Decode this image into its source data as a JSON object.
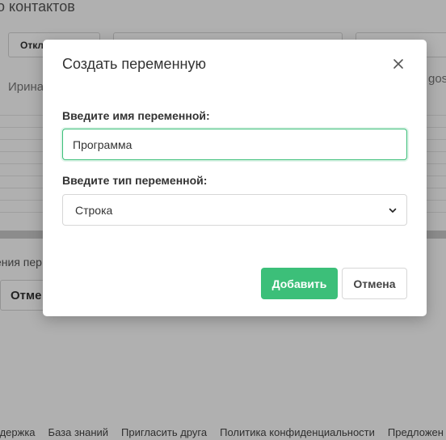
{
  "background": {
    "page_title": "о контактов",
    "toolbar_button": "Откл",
    "contact_name": "Ирина",
    "contact_right": "gos",
    "section_text": "ения пер",
    "cancel_label": "Отме"
  },
  "footer": {
    "links": [
      "ддержка",
      "База знаний",
      "Пригласить друга",
      "Политика конфиденциальности",
      "Предложен"
    ]
  },
  "modal": {
    "title": "Создать переменную",
    "close_icon": "close-icon",
    "name_label": "Введите имя переменной:",
    "name_value": "Программа",
    "type_label": "Введите тип переменной:",
    "type_value": "Строка",
    "add_label": "Добавить",
    "cancel_label": "Отмена"
  },
  "colors": {
    "accent": "#3cbf79",
    "overlay": "rgba(0,0,0,0.30)"
  }
}
